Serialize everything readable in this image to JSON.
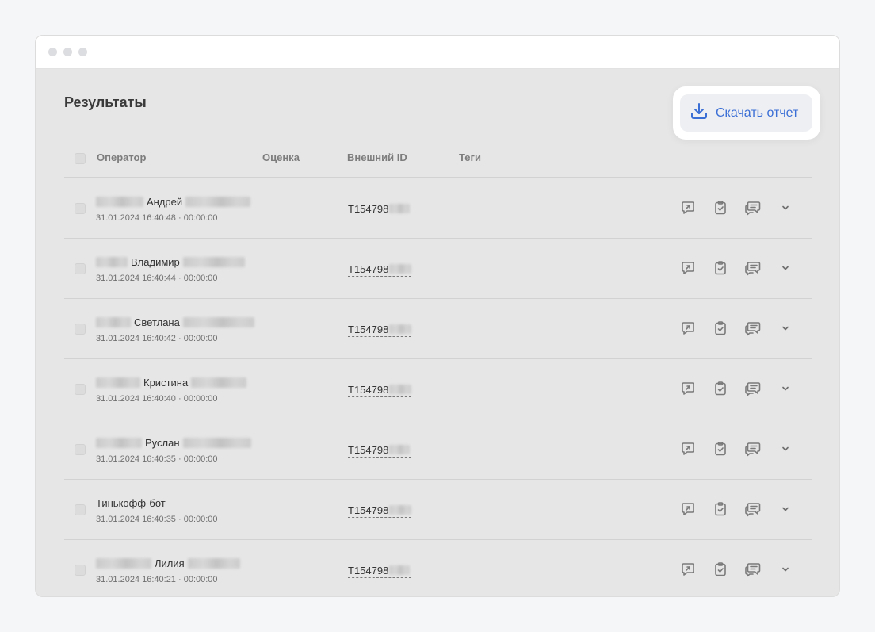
{
  "page_title": "Результаты",
  "download_label": "Скачать отчет",
  "columns": {
    "operator": "Оператор",
    "rating": "Оценка",
    "external_id": "Внешний ID",
    "tags": "Теги"
  },
  "icons": {
    "download": "download-icon",
    "open": "open-dialog-icon",
    "checklist": "clipboard-check-icon",
    "comments": "comments-icon",
    "expand": "chevron-down-icon"
  },
  "colors": {
    "accent": "#3b6fd6"
  },
  "rows": [
    {
      "name": "Андрей",
      "time": "31.01.2024 16:40:48 · 00:00:00",
      "ext_id": "T154798"
    },
    {
      "name": "Владимир",
      "time": "31.01.2024 16:40:44 · 00:00:00",
      "ext_id": "T154798"
    },
    {
      "name": "Светлана",
      "time": "31.01.2024 16:40:42 · 00:00:00",
      "ext_id": "T154798"
    },
    {
      "name": "Кристина",
      "time": "31.01.2024 16:40:40 · 00:00:00",
      "ext_id": "T154798"
    },
    {
      "name": "Руслан",
      "time": "31.01.2024 16:40:35 · 00:00:00",
      "ext_id": "T154798"
    },
    {
      "name": "Тинькофф-бот",
      "time": "31.01.2024 16:40:35 · 00:00:00",
      "ext_id": "T154798"
    },
    {
      "name": "Лилия",
      "time": "31.01.2024 16:40:21 · 00:00:00",
      "ext_id": "T154798"
    }
  ]
}
